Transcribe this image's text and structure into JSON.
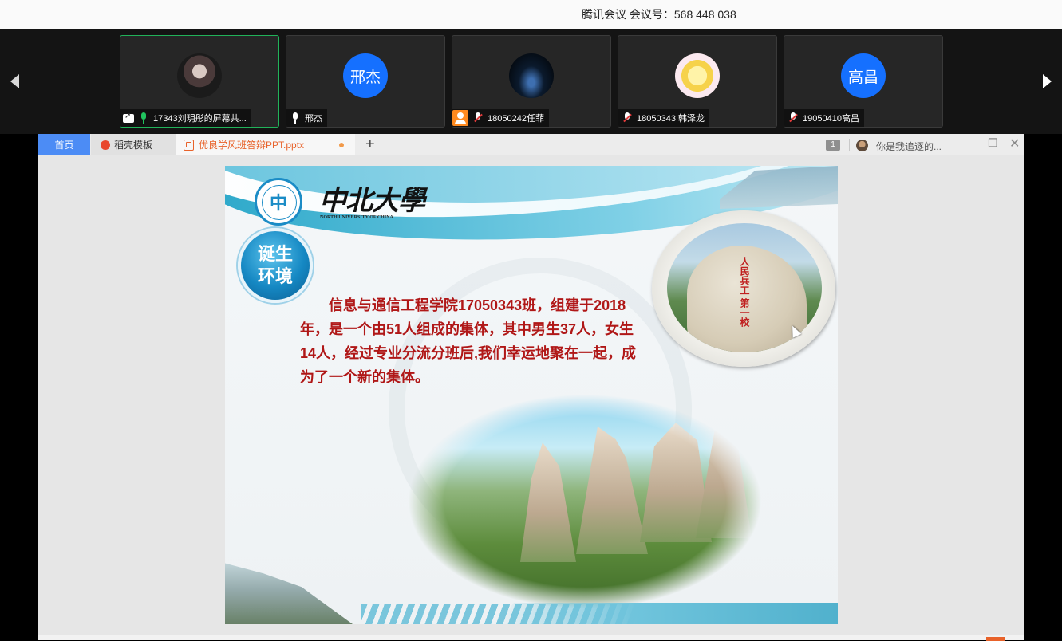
{
  "meeting": {
    "title": "腾讯会议 会议号：568 448 038"
  },
  "participants": [
    {
      "name": "17343刘玥彤的屏幕共...",
      "avatar_text": "",
      "mic": "on",
      "sharing": true,
      "active": true
    },
    {
      "name": "邢杰",
      "avatar_text": "邢杰",
      "mic": "unmuted",
      "sharing": false,
      "active": false
    },
    {
      "name": "18050242任菲",
      "avatar_text": "",
      "mic": "muted",
      "sharing": false,
      "active": false
    },
    {
      "name": "18050343 韩泽龙",
      "avatar_text": "",
      "mic": "muted",
      "sharing": false,
      "active": false
    },
    {
      "name": "19050410高昌",
      "avatar_text": "高昌",
      "mic": "muted",
      "sharing": false,
      "active": false
    }
  ],
  "wps": {
    "tabs": {
      "home": "首页",
      "daoke": "稻壳模板",
      "doc": "优良学风班答辩PPT.pptx"
    },
    "window_count": "1",
    "user": "你是我追逐的..."
  },
  "slide": {
    "university_cn": "中北大學",
    "university_en": "NORTH UNIVERSITY OF CHINA",
    "badge": [
      "诞生",
      "环境"
    ],
    "body": "信息与通信工程学院17050343班，组建于2018年，是一个由51人组成的集体，其中男生37人，女生14人，经过专业分流分班后,我们幸运地聚在一起，成为了一个新的集体。",
    "rock_text": "人民兵工 第一校"
  },
  "colors": {
    "accent": "#4c8cf5",
    "active_border": "#21b35a",
    "slide_text": "#b01717",
    "avatar_blue": "#1570ff"
  }
}
